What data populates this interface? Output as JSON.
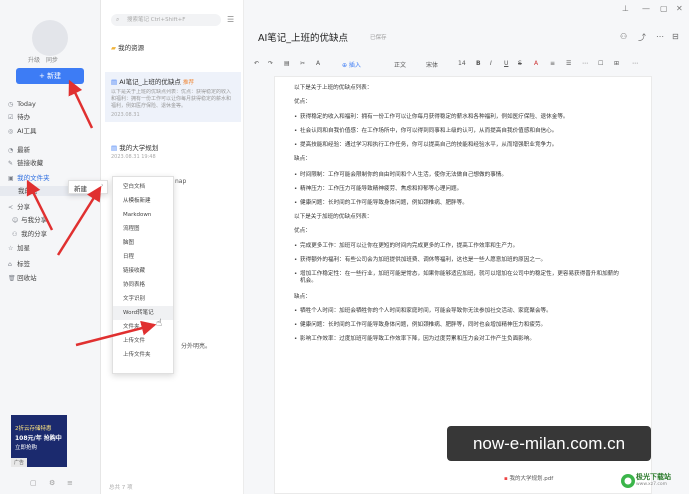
{
  "sidebar": {
    "upgrade": "升级",
    "sync": "同步",
    "new_button": "+ 新建",
    "items": [
      {
        "icon": "clock-icon",
        "glyph": "◷",
        "label": "Today"
      },
      {
        "icon": "checkbox-icon",
        "glyph": "☑",
        "label": "待办"
      },
      {
        "icon": "ai-icon",
        "glyph": "◎",
        "label": "AI工具"
      },
      {
        "icon": "recent-icon",
        "glyph": "◔",
        "label": "最新"
      },
      {
        "icon": "link-icon",
        "glyph": "✎",
        "label": "链接收藏"
      },
      {
        "icon": "folder-icon",
        "glyph": "▣",
        "label": "我的文件夹"
      },
      {
        "icon": "folder-icon",
        "glyph": "",
        "label": "我的资"
      },
      {
        "icon": "share-icon",
        "glyph": "≺",
        "label": "分享"
      },
      {
        "icon": "share-with-me-icon",
        "glyph": "☺",
        "label": "与我分享"
      },
      {
        "icon": "my-share-icon",
        "glyph": "⚇",
        "label": "我的分享"
      },
      {
        "icon": "star-icon",
        "glyph": "☆",
        "label": "加星"
      },
      {
        "icon": "tag-icon",
        "glyph": "⌂",
        "label": "标签"
      },
      {
        "icon": "trash-icon",
        "glyph": "🗑",
        "label": "回收站"
      }
    ],
    "promo": {
      "line1": "2折云存储特惠",
      "line2": "108元/年 抢购中",
      "line3": "立即抢购",
      "ad": "广告"
    },
    "bottom_icons": [
      "▢",
      "⚙",
      "≡"
    ]
  },
  "list": {
    "search_placeholder": "搜索笔记 Ctrl+Shift+F",
    "folder_name": "我的资源",
    "notes": [
      {
        "title": "AI笔记_上班的优缺点",
        "tag": "推荐",
        "snippet": "以下是关于上班的优缺点列表：优点：获得稳定的收入和福利：拥有一份工作可以让你每月获得稳定的薪水和福利，例如医疗保险、退休金等。",
        "date": "2023.08.31"
      },
      {
        "title": "我的大学规划",
        "tag": "",
        "snippet": "",
        "date": "2023.08.31 19:48"
      }
    ],
    "snippet_frag1": "nap",
    "snippet_frag2": "分外明亮。",
    "footer": "总共 7 项"
  },
  "context_menu_1": {
    "label": "新建"
  },
  "context_menu_2": {
    "items": [
      "空白文档",
      "从模板新建",
      "Markdown",
      "流程图",
      "脑图",
      "日程",
      "链接收藏",
      "协同表格",
      "文字识别",
      "Word转笔记",
      "文件夹",
      "上传文件",
      "上传文件夹"
    ],
    "hover_index": 9
  },
  "editor": {
    "title": "AI笔记_上班的优缺点",
    "status": "已保存",
    "toolbar": [
      "↶",
      "↷",
      "▤",
      "✂",
      "A",
      "⊕ 插入",
      "正文",
      "宋体",
      "14",
      "B",
      "I",
      "U",
      "S",
      "A",
      "≡",
      "☰",
      "⋯",
      "☐",
      "⊞",
      "⋯"
    ],
    "content": [
      {
        "kind": "p",
        "text": "以下是关于上班的优缺点列表："
      },
      {
        "kind": "p",
        "text": "优点："
      },
      {
        "kind": "li",
        "text": "获得稳定的收入和福利：拥有一份工作可以让你每月获得稳定的薪水和各种福利，例如医疗保险、退休金等。"
      },
      {
        "kind": "li",
        "text": "社会认同和自我价值感：在工作场所中，你可以得到同事和上级的认可，从而提高自我价值感和自信心。"
      },
      {
        "kind": "li",
        "text": "提高技能和经验：通过学习和执行工作任务，你可以提高自己的技能和经验水平，从而增强职业竞争力。"
      },
      {
        "kind": "p",
        "text": "缺点："
      },
      {
        "kind": "li",
        "text": "时间限制：工作可能会限制你的自由时间和个人生活，使你无法做自己想做的事情。"
      },
      {
        "kind": "li",
        "text": "精神压力：工作压力可能导致精神疲劳、焦虑和抑郁等心理问题。"
      },
      {
        "kind": "li",
        "text": "健康问题：长时间的工作可能导致身体问题，例如颈椎病、肥胖等。"
      },
      {
        "kind": "p",
        "text": "以下是关于加班的优缺点列表："
      },
      {
        "kind": "p",
        "text": "优点："
      },
      {
        "kind": "li",
        "text": "完成更多工作：加班可以让你在更短的时间内完成更多的工作，提高工作效率和生产力。"
      },
      {
        "kind": "li",
        "text": "获得额外的福利：有些公司会为加班提供加班费、调休等福利，这也是一些人愿意加班的原因之一。"
      },
      {
        "kind": "li",
        "text": "增加工作稳定性：在一些行业，加班可能是常态，如果你能够适应加班，就可以增加在公司中的稳定性，更容易获得晋升和加薪的机会。"
      },
      {
        "kind": "p",
        "text": "缺点："
      },
      {
        "kind": "li",
        "text": "牺牲个人时间：加班会牺牲你的个人时间和家庭时间，可能会导致你无法参加社交活动、家庭聚会等。"
      },
      {
        "kind": "li",
        "text": "健康问题：长时间的工作可能导致身体问题，例如颈椎病、肥胖等，同时也会增加精神压力和疲劳。"
      },
      {
        "kind": "li",
        "text": "影响工作效率：过度加班可能导致工作效率下降，因为过度劳累和压力会对工作产生负面影响。"
      }
    ],
    "attachment": "我的大学规划.pdf"
  },
  "watermark": "now-e-milan.com.cn",
  "logo": {
    "name": "极光下载站",
    "sub": "www.xz7.com"
  },
  "colors": {
    "accent": "#3d7cf5",
    "arrow": "#e03030"
  }
}
